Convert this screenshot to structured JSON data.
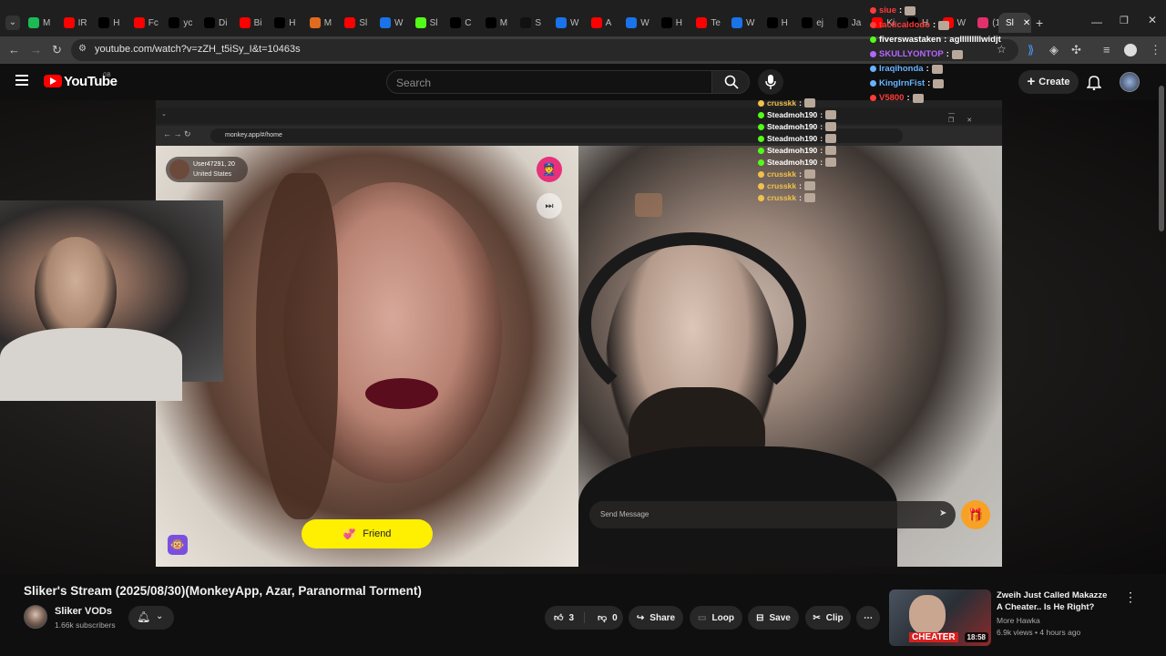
{
  "browser": {
    "tabs": [
      {
        "label": "M",
        "color": "#1db954"
      },
      {
        "label": "IR",
        "color": "#ff0000"
      },
      {
        "label": "H",
        "color": "#000000"
      },
      {
        "label": "Fc",
        "color": "#ff0000"
      },
      {
        "label": "yc",
        "color": "#000000"
      },
      {
        "label": "Di",
        "color": "#000000"
      },
      {
        "label": "Bi",
        "color": "#ff0000"
      },
      {
        "label": "H",
        "color": "#000000"
      },
      {
        "label": "M",
        "color": "#e06b1f"
      },
      {
        "label": "Sl",
        "color": "#ff0000"
      },
      {
        "label": "W",
        "color": "#1a73e8"
      },
      {
        "label": "Sl",
        "color": "#53fc18"
      },
      {
        "label": "C",
        "color": "#000000"
      },
      {
        "label": "M",
        "color": "#000000"
      },
      {
        "label": "S",
        "color": "#111111"
      },
      {
        "label": "W",
        "color": "#1a73e8"
      },
      {
        "label": "A",
        "color": "#ff0000"
      },
      {
        "label": "W",
        "color": "#1a73e8"
      },
      {
        "label": "H",
        "color": "#000000"
      },
      {
        "label": "Te",
        "color": "#ff0000"
      },
      {
        "label": "W",
        "color": "#1a73e8"
      },
      {
        "label": "H",
        "color": "#000000"
      },
      {
        "label": "ej",
        "color": "#000000"
      },
      {
        "label": "Ja",
        "color": "#000000"
      },
      {
        "label": "Ki",
        "color": "#ff0000"
      },
      {
        "label": "H",
        "color": "#000000"
      },
      {
        "label": "W",
        "color": "#ff0000"
      },
      {
        "label": "(1",
        "color": "#e1306c"
      }
    ],
    "active_tab": "Sl",
    "url": "youtube.com/watch?v=zZH_t5iSy_I&t=10463s"
  },
  "youtube": {
    "logo_text": "YouTube",
    "region": "GB",
    "search_placeholder": "Search",
    "create_label": "Create"
  },
  "inner_browser": {
    "url": "monkey.app/#/home",
    "user_name": "User47291, 20",
    "user_country": "United States",
    "friend_label": "Friend",
    "message_placeholder": "Send Message"
  },
  "chat": [
    {
      "user": "siue",
      "msg": "",
      "color": "#ff3b3b",
      "big": true
    },
    {
      "user": "tacticaldodo",
      "msg": "",
      "color": "#ff3b3b",
      "big": true
    },
    {
      "user": "fiverswastaken",
      "msg": "aglllllllllwidjt",
      "color": "#ffffff",
      "big": true
    },
    {
      "user": "SKULLYONTOP",
      "msg": "",
      "color": "#b366ff",
      "big": true
    },
    {
      "user": "Iraqihonda",
      "msg": "",
      "color": "#66b3ff",
      "big": true
    },
    {
      "user": "KingIrnFist",
      "msg": "",
      "color": "#66b3ff",
      "big": true
    },
    {
      "user": "V5800",
      "msg": "",
      "color": "#ff3b3b",
      "big": true
    },
    {
      "user": "crusskk",
      "msg": "",
      "color": "#f0c24a",
      "big": false
    },
    {
      "user": "Steadmoh190",
      "msg": "",
      "color": "#ffffff",
      "big": false
    },
    {
      "user": "Steadmoh190",
      "msg": "",
      "color": "#ffffff",
      "big": false
    },
    {
      "user": "Steadmoh190",
      "msg": "",
      "color": "#ffffff",
      "big": false
    },
    {
      "user": "Steadmoh190",
      "msg": "",
      "color": "#ffffff",
      "big": false
    },
    {
      "user": "Steadmoh190",
      "msg": "",
      "color": "#ffffff",
      "big": false
    },
    {
      "user": "crusskk",
      "msg": "",
      "color": "#f0c24a",
      "big": false
    },
    {
      "user": "crusskk",
      "msg": "",
      "color": "#f0c24a",
      "big": false
    },
    {
      "user": "crusskk",
      "msg": "",
      "color": "#f0c24a",
      "big": false
    }
  ],
  "video": {
    "title": "Sliker's Stream (2025/08/30)(MonkeyApp, Azar, Paranormal Torment)",
    "channel": "Sliker VODs",
    "subscribers": "1.66k subscribers",
    "likes": "3",
    "dislikes": "0",
    "share_label": "Share",
    "loop_label": "Loop",
    "save_label": "Save",
    "clip_label": "Clip"
  },
  "recommended": {
    "title": "Zweih Just Called Makazze A Cheater.. Is He Right?",
    "channel": "More Hawka",
    "meta": "6.9k views • 4 hours ago",
    "duration": "18:58",
    "thumb_text": "CHEATER"
  }
}
